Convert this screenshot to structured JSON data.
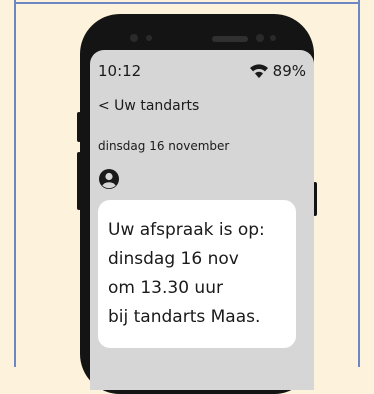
{
  "status_bar": {
    "time": "10:12",
    "battery": "89%",
    "wifi_icon": "wifi-icon"
  },
  "header": {
    "back_label": "< Uw tandarts"
  },
  "conversation": {
    "date": "dinsdag 16 november",
    "sender_icon": "user-avatar-icon"
  },
  "message": {
    "lines": [
      "Uw afspraak is op:",
      "dinsdag 16 nov",
      "om 13.30 uur",
      "bij tandarts Maas."
    ]
  },
  "colors": {
    "background": "#fdf3dc",
    "frame": "#6d87c4",
    "phone_body": "#141414",
    "screen": "#d6d6d6",
    "bubble": "#ffffff"
  }
}
